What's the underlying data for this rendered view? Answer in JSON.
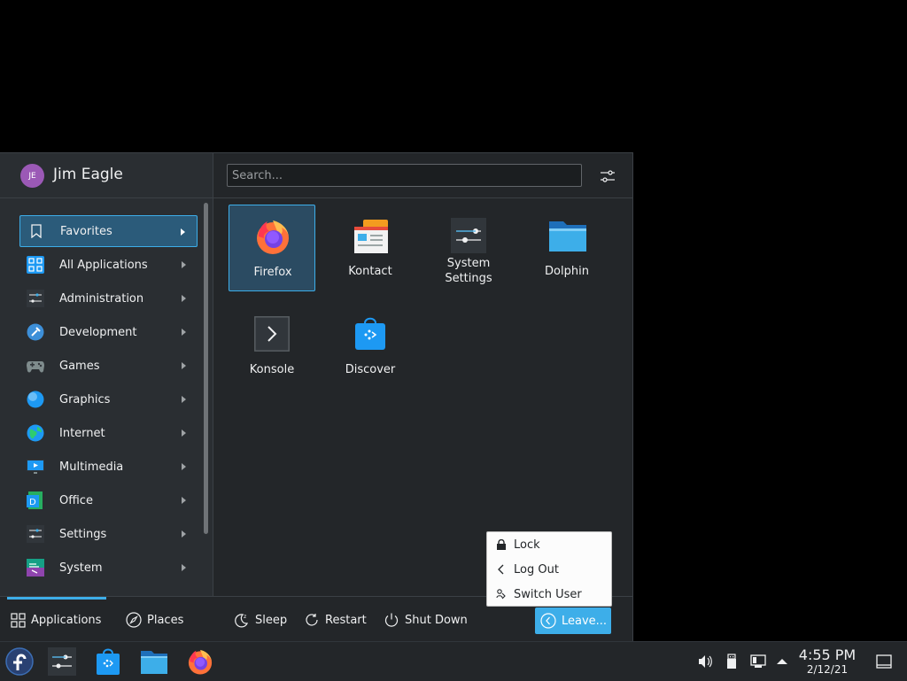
{
  "user": {
    "initials": "JE",
    "name": "Jim Eagle"
  },
  "search": {
    "placeholder": "Search..."
  },
  "categories": [
    {
      "label": "Favorites",
      "icon": "bookmark-icon"
    },
    {
      "label": "All Applications",
      "icon": "grid-icon"
    },
    {
      "label": "Administration",
      "icon": "admin-icon"
    },
    {
      "label": "Development",
      "icon": "development-icon"
    },
    {
      "label": "Games",
      "icon": "gamepad-icon"
    },
    {
      "label": "Graphics",
      "icon": "graphics-icon"
    },
    {
      "label": "Internet",
      "icon": "globe-icon"
    },
    {
      "label": "Multimedia",
      "icon": "multimedia-icon"
    },
    {
      "label": "Office",
      "icon": "office-icon"
    },
    {
      "label": "Settings",
      "icon": "settings-icon"
    },
    {
      "label": "System",
      "icon": "system-icon"
    }
  ],
  "favorites": [
    {
      "label": "Firefox",
      "icon": "firefox-icon"
    },
    {
      "label": "Kontact",
      "icon": "kontact-icon"
    },
    {
      "label": "System Settings",
      "line1": "System",
      "line2": "Settings",
      "icon": "system-settings-icon"
    },
    {
      "label": "Dolphin",
      "icon": "dolphin-icon"
    },
    {
      "label": "Konsole",
      "icon": "konsole-icon"
    },
    {
      "label": "Discover",
      "icon": "discover-icon"
    }
  ],
  "bottom": {
    "applications": "Applications",
    "places": "Places",
    "sleep": "Sleep",
    "restart": "Restart",
    "shutdown": "Shut Down",
    "leave": "Leave..."
  },
  "leave_menu": {
    "lock": "Lock",
    "logout": "Log Out",
    "switch_user": "Switch User"
  },
  "clock": {
    "time": "4:55 PM",
    "date": "2/12/21"
  },
  "colors": {
    "accent": "#3daee9",
    "panel": "#232629",
    "selected": "#2b5b7a"
  }
}
